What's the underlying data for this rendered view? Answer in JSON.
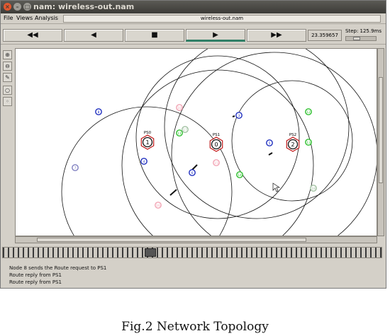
{
  "window": {
    "title": "nam: wireless-out.nam",
    "controls": {
      "close": "×",
      "min": "–",
      "max": "□"
    }
  },
  "menubar": {
    "items": [
      "File",
      "Views",
      "Analysis"
    ],
    "filename": "wireless-out.nam"
  },
  "playback": {
    "rewind": "◀◀",
    "back": "◀",
    "stop": "■",
    "play": "▶",
    "fast_forward": "▶▶",
    "time": "23.359657",
    "step_label": "Step: 125.9ms"
  },
  "toolbar_icons": [
    "zoom-in-icon",
    "zoom-out-icon",
    "edit-icon",
    "node-icon",
    "link-icon"
  ],
  "nodes": [
    {
      "label": "1",
      "tag": "PS0",
      "role": "server",
      "color": "#111111"
    },
    {
      "label": "0",
      "tag": "PS1",
      "role": "server",
      "color": "#111111"
    },
    {
      "label": "2",
      "tag": "PS2",
      "role": "server",
      "color": "#111111"
    },
    {
      "label": "8",
      "role": "mobile",
      "color": "#1f2fbf"
    },
    {
      "label": "3",
      "role": "mobile",
      "color": "#1f2fbf"
    },
    {
      "label": "5",
      "role": "mobile",
      "color": "#1f2fbf"
    },
    {
      "label": "4",
      "role": "mobile",
      "color": "#1f2fbf"
    },
    {
      "label": "6",
      "role": "mobile",
      "color": "#1f2fbf"
    },
    {
      "label": "9",
      "role": "mobile",
      "color": "#1f2fbf"
    },
    {
      "label": "7",
      "role": "mobile",
      "color": "#8080c0"
    },
    {
      "label": "11",
      "role": "mobile",
      "color": "#2ec02e"
    },
    {
      "label": "12",
      "role": "mobile",
      "color": "#2ec02e"
    },
    {
      "label": "13",
      "role": "mobile",
      "color": "#2ec02e"
    },
    {
      "label": "14",
      "role": "mobile",
      "color": "#2ec02e"
    },
    {
      "label": "10",
      "role": "mobile",
      "color": "#f2a4b4"
    },
    {
      "label": "15",
      "role": "mobile",
      "color": "#f2a4b4"
    },
    {
      "label": "16",
      "role": "mobile",
      "color": "#f2a4b4"
    },
    {
      "label": "17",
      "role": "mobile",
      "color": "#a0c0a0"
    },
    {
      "label": "18",
      "role": "mobile",
      "color": "#a0c0a0"
    }
  ],
  "annotations": [
    "Node 8 sends the Route request to PS1",
    "Route reply from PS1",
    "Route reply from PS1"
  ],
  "caption": "Fig.2 Network Topology"
}
